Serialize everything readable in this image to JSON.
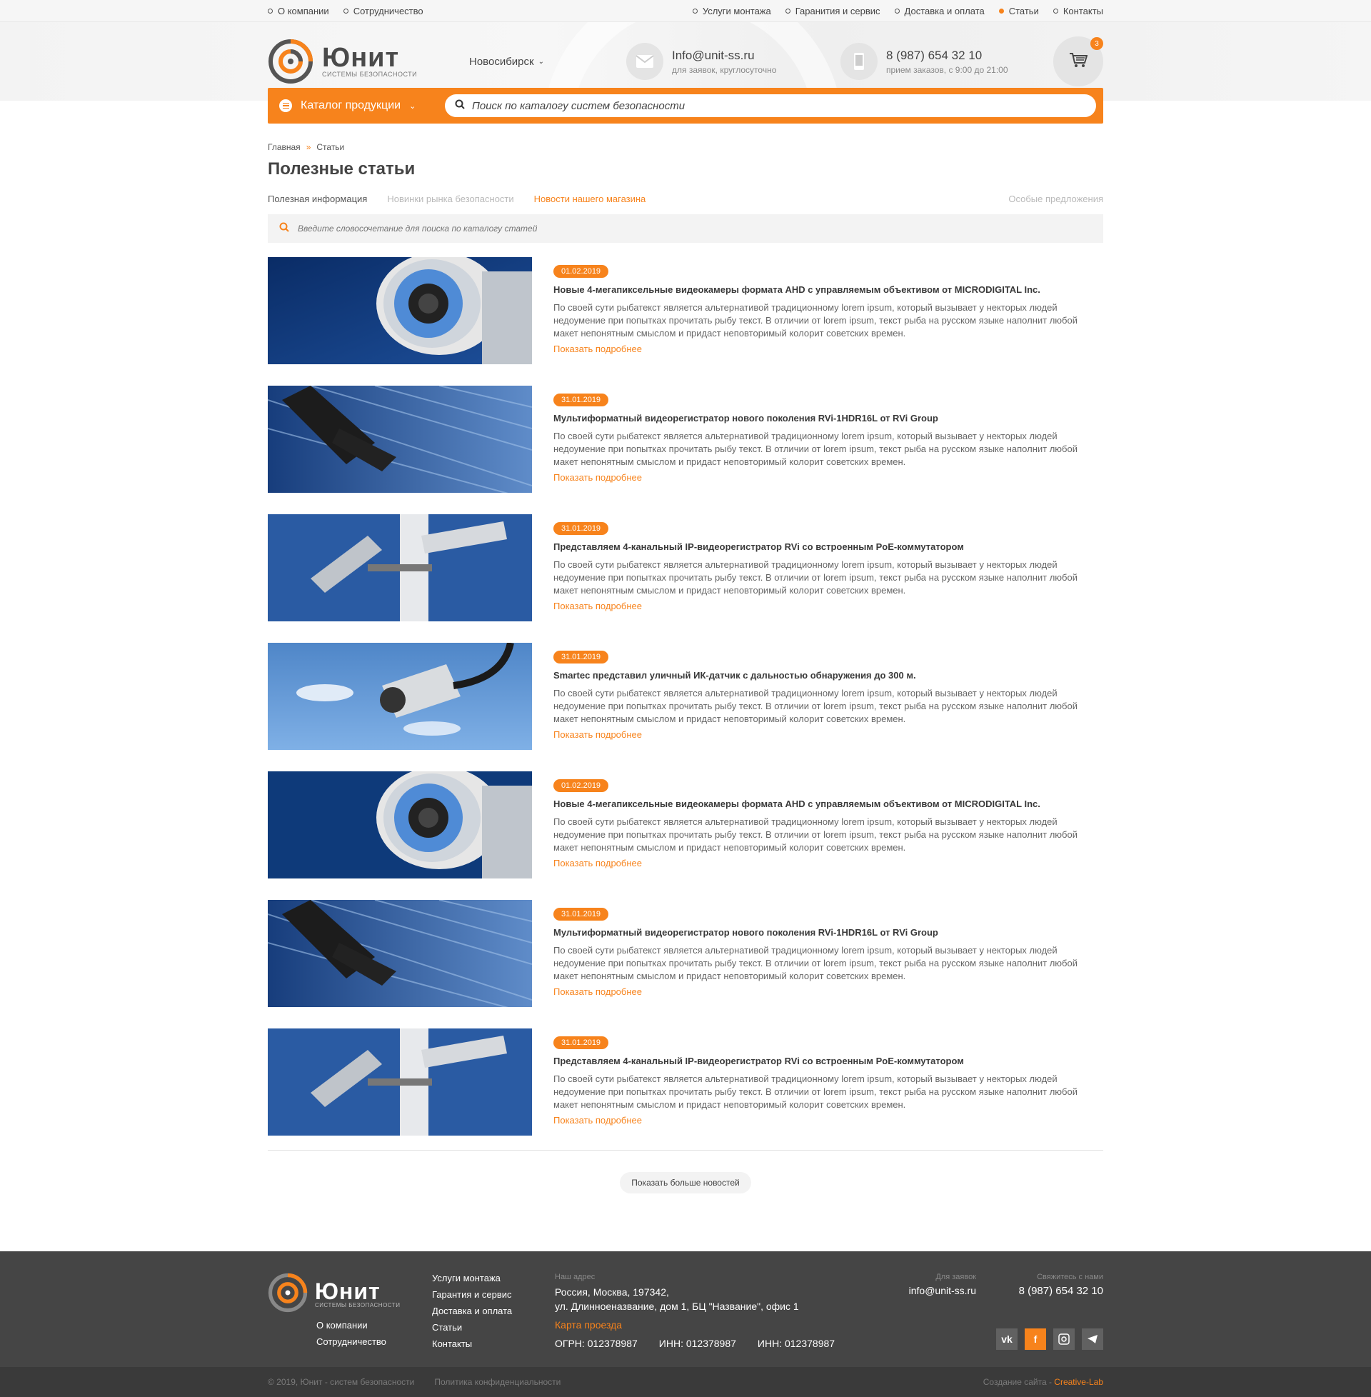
{
  "topbar": {
    "left": [
      "О компании",
      "Сотрудничество"
    ],
    "right": [
      "Услуги монтажа",
      "Гаранития и сервис",
      "Доставка и оплата",
      "Статьи",
      "Контакты"
    ]
  },
  "header": {
    "logo_name": "Юнит",
    "logo_sub": "системы безопасности",
    "city": "Новосибирск",
    "email": "Info@unit-ss.ru",
    "email_note": "для заявок, круглосуточно",
    "phone": "8 (987) 654 32 10",
    "phone_note": "прием заказов, с 9:00 до 21:00",
    "cart_count": "3"
  },
  "nav": {
    "catalog_label": "Каталог продукции",
    "search_placeholder": "Поиск по каталогу систем безопасности"
  },
  "breadcrumb": {
    "home": "Главная",
    "sep": "»",
    "current": "Статьи"
  },
  "page_title": "Полезные статьи",
  "tabs": {
    "t1": "Полезная информация",
    "t2": "Новинки рынка безопасности",
    "t3": "Новости нашего магазина",
    "t4": "Особые предложения"
  },
  "article_search_placeholder": "Введите словосочетание для поиска по каталогу статей",
  "articles": [
    {
      "date": "01.02.2019",
      "title": "Новые 4-мегапиксельные видеокамеры формата AHD с управляемым объективом от MICRODIGITAL Inc.",
      "text": "По своей сути рыбатекст является альтернативой традиционному lorem ipsum, который вызывает у некторых людей недоумение при попытках прочитать рыбу текст. В отличии от lorem ipsum, текст рыба на русском языке наполнит любой макет непонятным смыслом и придаст неповторимый колорит советских времен.",
      "more": "Показать подробнее"
    },
    {
      "date": "31.01.2019",
      "title": "Мультиформатный видеорегистратор нового поколения RVi-1HDR16L от RVi Group",
      "text": "По своей сути рыбатекст является альтернативой традиционному lorem ipsum, который вызывает у некторых людей недоумение при попытках прочитать рыбу текст. В отличии от lorem ipsum, текст рыба на русском языке наполнит любой макет непонятным смыслом и придаст неповторимый колорит советских времен.",
      "more": "Показать подробнее"
    },
    {
      "date": "31.01.2019",
      "title": "Представляем 4-канальный IP-видеорегистратор RVi со встроенным PoE-коммутатором",
      "text": "По своей сути рыбатекст является альтернативой традиционному lorem ipsum, который вызывает у некторых людей недоумение при попытках прочитать рыбу текст. В отличии от lorem ipsum, текст рыба на русском языке наполнит любой макет непонятным смыслом и придаст неповторимый колорит советских времен.",
      "more": "Показать подробнее"
    },
    {
      "date": "31.01.2019",
      "title": "Smartec представил уличный ИК-датчик с дальностью обнаружения до 300 м.",
      "text": "По своей сути рыбатекст является альтернативой традиционному lorem ipsum, который вызывает у некторых людей недоумение при попытках прочитать рыбу текст. В отличии от lorem ipsum, текст рыба на русском языке наполнит любой макет непонятным смыслом и придаст неповторимый колорит советских времен.",
      "more": "Показать подробнее"
    },
    {
      "date": "01.02.2019",
      "title": "Новые 4-мегапиксельные видеокамеры формата AHD с управляемым объективом от MICRODIGITAL Inc.",
      "text": "По своей сути рыбатекст является альтернативой традиционному lorem ipsum, который вызывает у некторых людей недоумение при попытках прочитать рыбу текст. В отличии от lorem ipsum, текст рыба на русском языке наполнит любой макет непонятным смыслом и придаст неповторимый колорит советских времен.",
      "more": "Показать подробнее"
    },
    {
      "date": "31.01.2019",
      "title": "Мультиформатный видеорегистратор нового поколения RVi-1HDR16L от RVi Group",
      "text": "По своей сути рыбатекст является альтернативой традиционному lorem ipsum, который вызывает у некторых людей недоумение при попытках прочитать рыбу текст. В отличии от lorem ipsum, текст рыба на русском языке наполнит любой макет непонятным смыслом и придаст неповторимый колорит советских времен.",
      "more": "Показать подробнее"
    },
    {
      "date": "31.01.2019",
      "title": "Представляем 4-канальный IP-видеорегистратор RVi со встроенным PoE-коммутатором",
      "text": "По своей сути рыбатекст является альтернативой традиционному lorem ipsum, который вызывает у некторых людей недоумение при попытках прочитать рыбу текст. В отличии от lorem ipsum, текст рыба на русском языке наполнит любой макет непонятным смыслом и придаст неповторимый колорит советских времен.",
      "more": "Показать подробнее"
    }
  ],
  "more_news_button": "Показать больше новостей",
  "footer": {
    "logo_name": "Юнит",
    "logo_sub": "системы безопасности",
    "left_links": [
      "О компании",
      "Сотрудничество"
    ],
    "links": [
      "Услуги монтажа",
      "Гарантия и сервис",
      "Доставка и оплата",
      "Статьи",
      "Контакты"
    ],
    "address_label": "Наш адрес",
    "address_line1": "Россия, Москва, 197342,",
    "address_line2": "ул. Длинноеназвание, дом 1, БЦ \"Название\", офис 1",
    "map_link": "Карта проезда",
    "ogrn": "ОГРН: 012378987",
    "inn1": "ИНН: 012378987",
    "inn2": "ИНН: 012378987",
    "email_label": "Для заявок",
    "email": "info@unit-ss.ru",
    "phone_label": "Свяжитесь с нами",
    "phone": "8 (987) 654 32 10",
    "socials": [
      "vk-icon",
      "facebook-icon",
      "instagram-icon",
      "telegram-icon"
    ],
    "copyright": "© 2019, Юнит - систем безопасности",
    "privacy": "Политика конфиденциальности",
    "creator_prefix": "Создание сайта - ",
    "creator_name": "Creative-Lab"
  },
  "colors": {
    "accent": "#f7831c",
    "footer_bg": "#454545"
  }
}
